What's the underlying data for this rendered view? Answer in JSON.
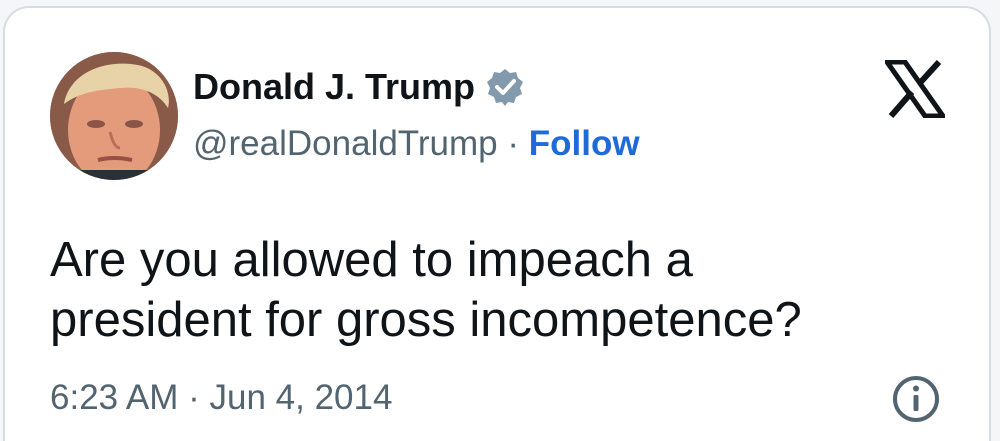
{
  "author": {
    "name": "Donald J. Trump",
    "handle": "@realDonaldTrump",
    "separator": "·",
    "follow_label": "Follow",
    "verified": true
  },
  "tweet": {
    "lines": [
      "Are you allowed to impeach a",
      "president for gross incompetence?"
    ],
    "timestamp": "6:23 AM · Jun 4, 2014"
  },
  "icons": {
    "brand": "x-logo-icon",
    "info": "info-icon",
    "verified": "verified-badge-icon"
  },
  "colors": {
    "text": "#0f1419",
    "secondary": "#536471",
    "link": "#1d6ad8",
    "badge": "#829aab",
    "border": "#d6dce3"
  }
}
